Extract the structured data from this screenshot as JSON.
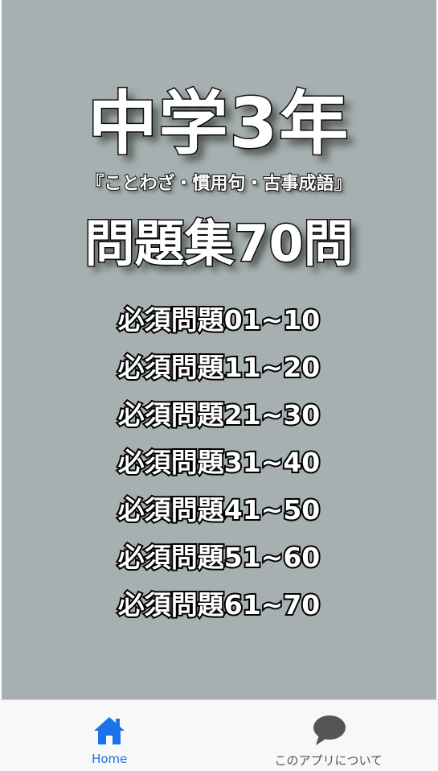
{
  "title": {
    "main": "中学3年",
    "subtitle": "『ことわざ・慣用句・古事成語』",
    "count": "問題集70問"
  },
  "menu": {
    "items": [
      {
        "label": "必須問題01~10"
      },
      {
        "label": "必須問題11~20"
      },
      {
        "label": "必須問題21~30"
      },
      {
        "label": "必須問題31~40"
      },
      {
        "label": "必須問題41~50"
      },
      {
        "label": "必須問題51~60"
      },
      {
        "label": "必須問題61~70"
      }
    ]
  },
  "tabbar": {
    "home": {
      "label": "Home",
      "icon": "home-icon",
      "active": true
    },
    "about": {
      "label": "このアプリについて",
      "icon": "speech-bubble-icon",
      "active": false
    }
  },
  "colors": {
    "background": "#a7b0b0",
    "text": "#ffffff",
    "outline": "#000000",
    "active_tab": "#1a73e8",
    "inactive_tab": "#555555",
    "tabbar_bg": "#f8f8f8"
  }
}
